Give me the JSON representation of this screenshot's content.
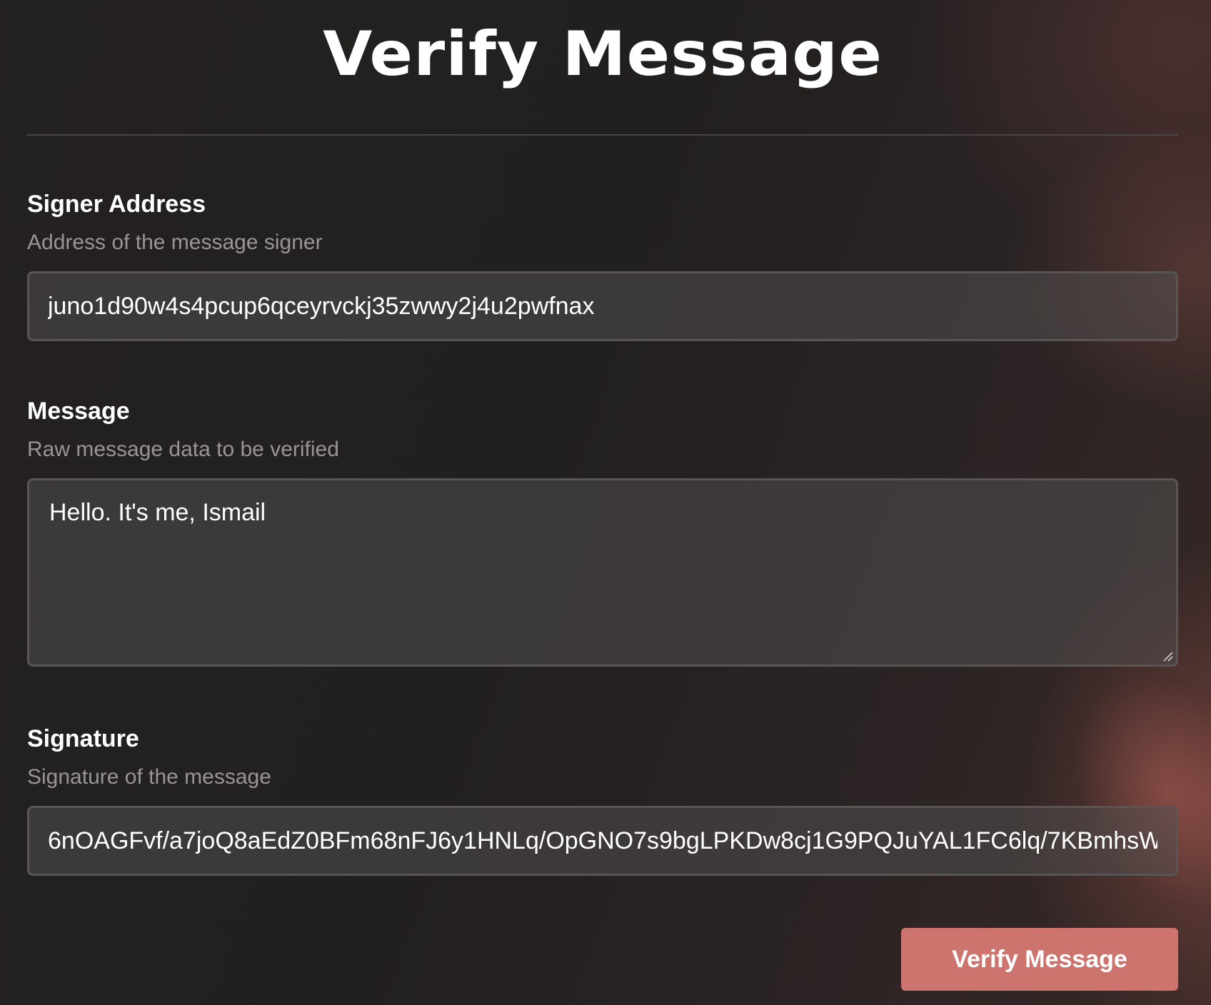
{
  "header": {
    "title": "Verify Message"
  },
  "fields": {
    "signer_address": {
      "label": "Signer Address",
      "description": "Address of the message signer",
      "value": "juno1d90w4s4pcup6qceyrvckj35zwwy2j4u2pwfnax"
    },
    "message": {
      "label": "Message",
      "description": "Raw message data to be verified",
      "value": "Hello. It's me, Ismail"
    },
    "signature": {
      "label": "Signature",
      "description": "Signature of the message",
      "value": "6nOAGFvf/a7joQ8aEdZ0BFm68nFJ6y1HNLq/OpGNO7s9bgLPKDw8cj1G9PQJuYAL1FC6lq/7KBmhsW"
    }
  },
  "actions": {
    "verify_label": "Verify Message"
  },
  "colors": {
    "button_bg": "#cd746f",
    "input_border": "#595555",
    "description_text": "#9a9595"
  },
  "icons": {
    "resize": "resize-handle-icon"
  }
}
